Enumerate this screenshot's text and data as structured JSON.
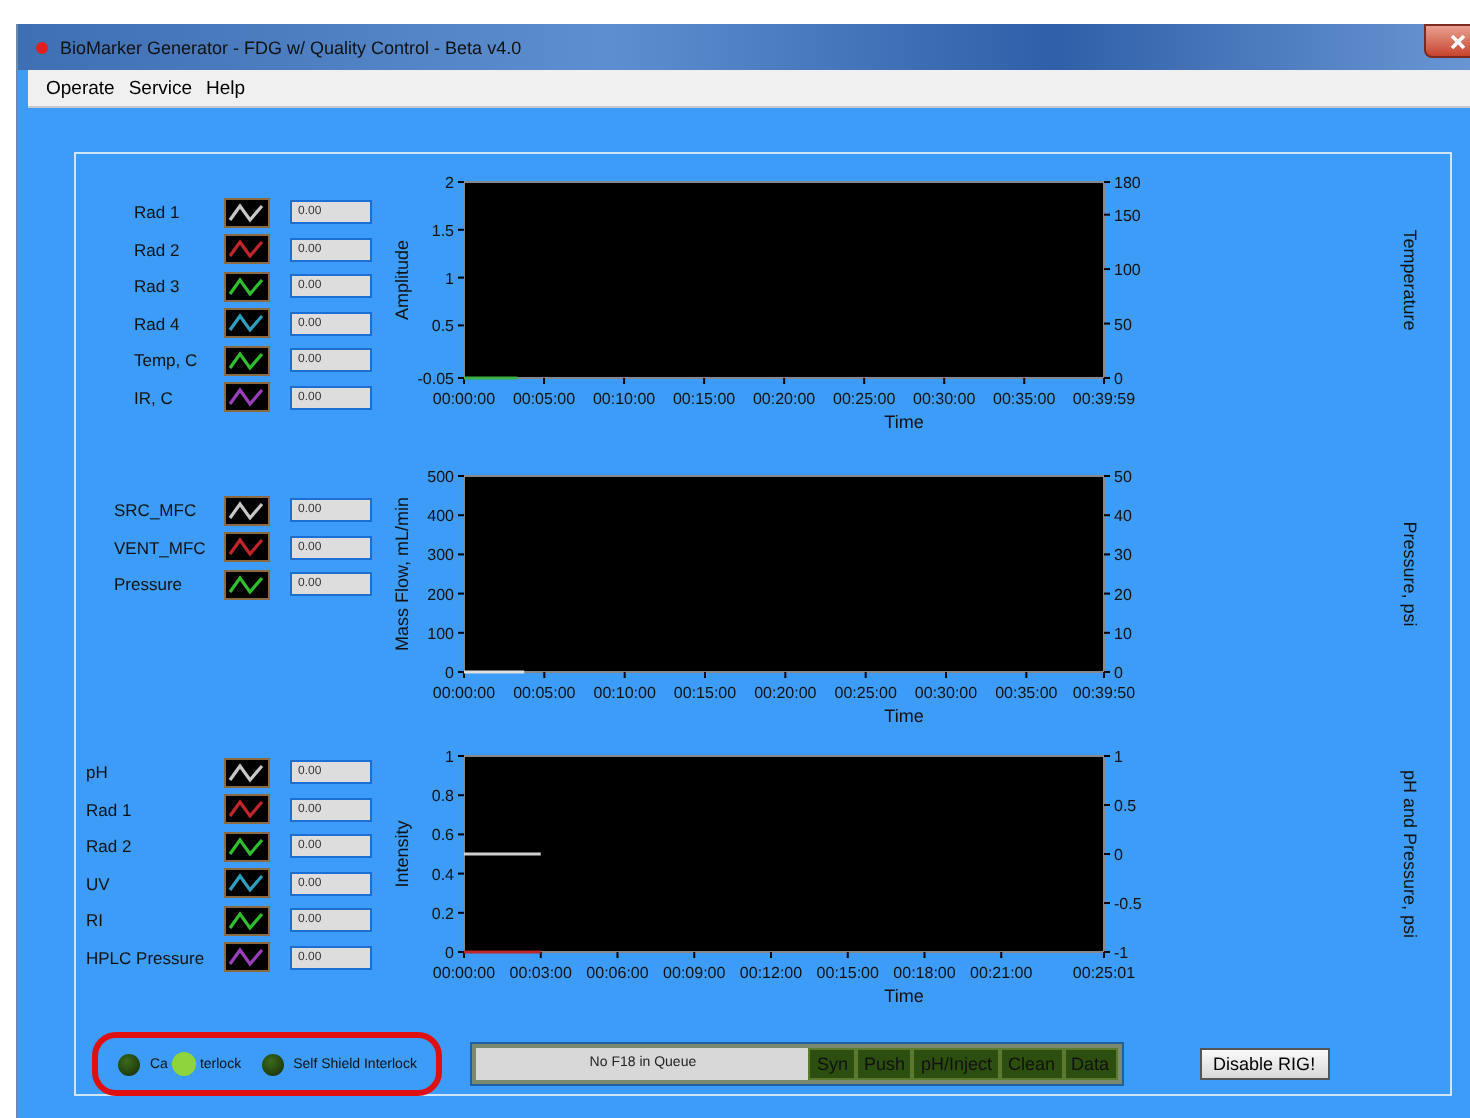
{
  "window": {
    "title": "BioMarker Generator - FDG w/ Quality Control - Beta v4.0"
  },
  "menu": [
    "Operate",
    "Service",
    "Help"
  ],
  "sections": [
    {
      "legend": [
        {
          "name": "Rad 1",
          "color": "#c8c8c8",
          "value": "0.00"
        },
        {
          "name": "Rad 2",
          "color": "#c0262b",
          "value": "0.00"
        },
        {
          "name": "Rad 3",
          "color": "#2fbf2f",
          "value": "0.00"
        },
        {
          "name": "Rad 4",
          "color": "#2f9fbf",
          "value": "0.00"
        },
        {
          "name": "Temp, C",
          "color": "#2fbf2f",
          "value": "0.00"
        },
        {
          "name": "IR, C",
          "color": "#9b3fbf",
          "value": "0.00"
        }
      ],
      "chart_data": {
        "type": "line",
        "xlabel": "Time",
        "ylabel": "Amplitude",
        "ylim": [
          -0.05,
          2
        ],
        "xlim": [
          0,
          2399
        ],
        "yticks": [
          2,
          1.5,
          1,
          0.5,
          -0.05
        ],
        "xticks": [
          {
            "value": 0,
            "label": "00:00:00"
          },
          {
            "value": 300,
            "label": "00:05:00"
          },
          {
            "value": 600,
            "label": "00:10:00"
          },
          {
            "value": 900,
            "label": "00:15:00"
          },
          {
            "value": 1200,
            "label": "00:20:00"
          },
          {
            "value": 1500,
            "label": "00:25:00"
          },
          {
            "value": 1800,
            "label": "00:30:00"
          },
          {
            "value": 2100,
            "label": "00:35:00"
          },
          {
            "value": 2399,
            "label": "00:39:59"
          }
        ],
        "x": [
          0,
          200
        ],
        "series": [
          {
            "color": "#3cb043",
            "values": [
              -0.05,
              -0.05
            ]
          }
        ],
        "y2label": "Temperature",
        "y2lim": [
          0,
          180
        ],
        "y2ticks": [
          180,
          150,
          100,
          50,
          0
        ]
      }
    },
    {
      "legend": [
        {
          "name": "SRC_MFC",
          "color": "#c8c8c8",
          "value": "0.00"
        },
        {
          "name": "VENT_MFC",
          "color": "#c0262b",
          "value": "0.00"
        },
        {
          "name": "Pressure",
          "color": "#2fbf2f",
          "value": "0.00"
        }
      ],
      "chart_data": {
        "type": "line",
        "xlabel": "Time",
        "ylabel": "Mass Flow, mL/min",
        "ylim": [
          0,
          500
        ],
        "xlim": [
          0,
          2390
        ],
        "yticks": [
          500,
          400,
          300,
          200,
          100,
          0
        ],
        "xticks": [
          {
            "value": 0,
            "label": "00:00:00"
          },
          {
            "value": 300,
            "label": "00:05:00"
          },
          {
            "value": 600,
            "label": "00:10:00"
          },
          {
            "value": 900,
            "label": "00:15:00"
          },
          {
            "value": 1200,
            "label": "00:20:00"
          },
          {
            "value": 1500,
            "label": "00:25:00"
          },
          {
            "value": 1800,
            "label": "00:30:00"
          },
          {
            "value": 2100,
            "label": "00:35:00"
          },
          {
            "value": 2390,
            "label": "00:39:50"
          }
        ],
        "x": [
          0,
          225
        ],
        "series": [
          {
            "color": "#e0e0e0",
            "values": [
              0,
              0
            ]
          }
        ],
        "y2label": "Pressure, psi",
        "y2lim": [
          0,
          50
        ],
        "y2ticks": [
          50,
          40,
          30,
          20,
          10,
          0
        ]
      }
    },
    {
      "legend": [
        {
          "name": "pH",
          "color": "#c8c8c8",
          "value": "0.00"
        },
        {
          "name": "Rad 1",
          "color": "#c0262b",
          "value": "0.00"
        },
        {
          "name": "Rad 2",
          "color": "#2fbf2f",
          "value": "0.00"
        },
        {
          "name": "UV",
          "color": "#2f9fbf",
          "value": "0.00"
        },
        {
          "name": "RI",
          "color": "#2fbf2f",
          "value": "0.00"
        },
        {
          "name": "HPLC Pressure",
          "color": "#9b3fbf",
          "value": "0.00"
        }
      ],
      "chart_data": {
        "type": "line",
        "xlabel": "Time",
        "ylabel": "Intensity",
        "ylim": [
          0,
          1
        ],
        "xlim": [
          0,
          1501
        ],
        "yticks": [
          1,
          0.8,
          0.6,
          0.4,
          0.2,
          0
        ],
        "xticks": [
          {
            "value": 0,
            "label": "00:00:00"
          },
          {
            "value": 180,
            "label": "00:03:00"
          },
          {
            "value": 360,
            "label": "00:06:00"
          },
          {
            "value": 540,
            "label": "00:09:00"
          },
          {
            "value": 720,
            "label": "00:12:00"
          },
          {
            "value": 900,
            "label": "00:15:00"
          },
          {
            "value": 1080,
            "label": "00:18:00"
          },
          {
            "value": 1260,
            "label": "00:21:00"
          },
          {
            "value": 1501,
            "label": "00:25:01"
          }
        ],
        "x": [
          0,
          180
        ],
        "series": [
          {
            "color": "#d0d0d0",
            "values": [
              0.5,
              0.5
            ]
          },
          {
            "color": "#c0262b",
            "values": [
              0,
              0
            ]
          }
        ],
        "y2label": "pH and Pressure, psi",
        "y2lim": [
          -1,
          1
        ],
        "y2ticks": [
          1,
          0.5,
          0,
          -0.5,
          -1
        ]
      }
    }
  ],
  "interlock_panel": {
    "highlighted": true,
    "items": [
      {
        "on": false,
        "label_parts": [
          "Ca",
          "terlock"
        ]
      },
      {
        "on": false,
        "label_parts": [
          "Self Shield Interlock"
        ]
      }
    ]
  },
  "queue": {
    "value": "No F18 in Queue"
  },
  "steps": [
    {
      "label": "Syn"
    },
    {
      "label": "Push"
    },
    {
      "label": "pH/Inject"
    },
    {
      "label": "Clean"
    },
    {
      "label": "Data"
    }
  ],
  "disable_button": "Disable RIG!"
}
